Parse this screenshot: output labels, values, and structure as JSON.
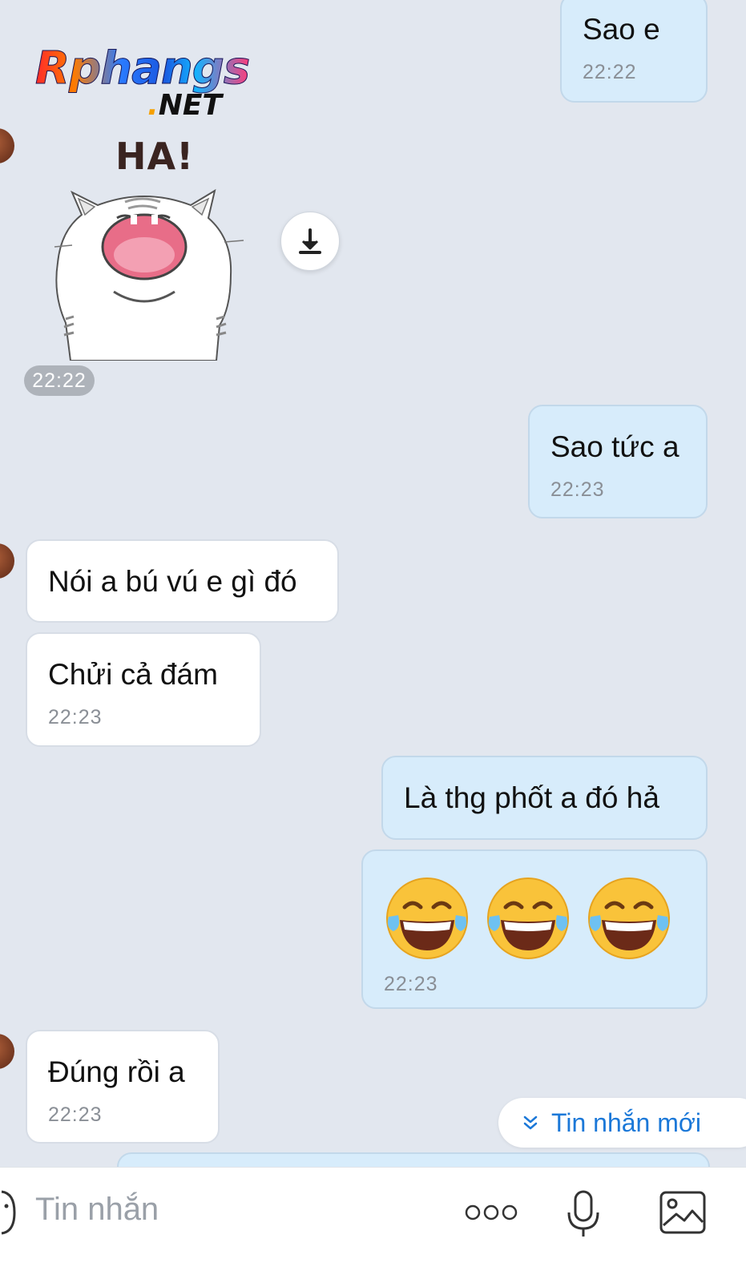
{
  "watermark": {
    "brand": "Rphangs",
    "suffix": ".NET"
  },
  "sticker": {
    "caption": "HA!",
    "time": "22:22"
  },
  "messages": [
    {
      "dir": "out",
      "text": "Sao e",
      "time": "22:22"
    },
    {
      "dir": "out",
      "text": "Sao tức a",
      "time": "22:23"
    },
    {
      "dir": "in",
      "text": "Nói a bú vú e gì đó"
    },
    {
      "dir": "in",
      "text": "Chửi cả đám",
      "time": "22:23"
    },
    {
      "dir": "out",
      "text": "Là thg phốt a đó hả"
    },
    {
      "dir": "out",
      "emoji": [
        "face-with-tears-of-joy",
        "face-with-tears-of-joy",
        "face-with-tears-of-joy"
      ],
      "time": "22:23"
    },
    {
      "dir": "in",
      "text": "Đúng rồi a",
      "time": "22:23"
    }
  ],
  "new_messages_chip": "Tin nhắn mới",
  "composer": {
    "placeholder": "Tin nhắn",
    "icons": [
      "sticker-icon",
      "more-icon",
      "microphone-icon",
      "image-icon"
    ]
  },
  "colors": {
    "background": "#e2e7ef",
    "outgoing_bubble": "#d7ecfb",
    "incoming_bubble": "#ffffff",
    "accent": "#1b78d8"
  }
}
